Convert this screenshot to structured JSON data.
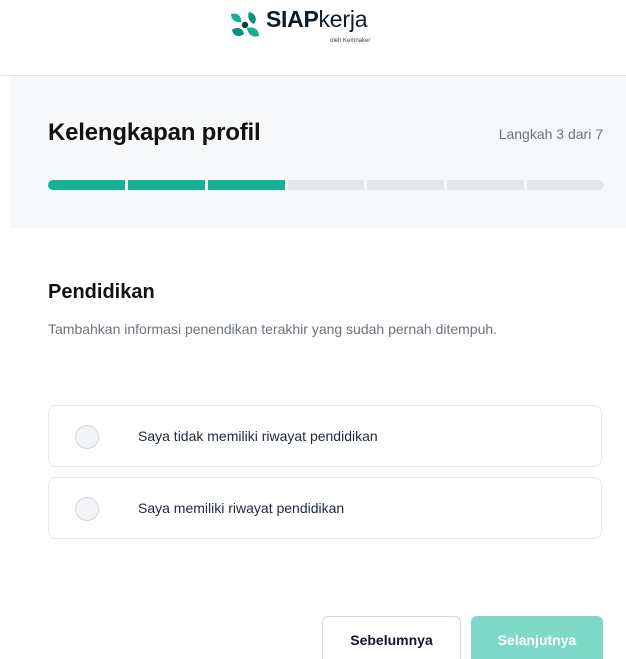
{
  "header": {
    "logo_brand_bold": "SIAP",
    "logo_brand_light": "kerja",
    "logo_sub": "oleh Kemnaker",
    "accent_color": "#16b097"
  },
  "profile": {
    "title": "Kelengkapan profil",
    "step_text": "Langkah 3 dari 7",
    "progress": {
      "current": 3,
      "total": 7
    }
  },
  "section": {
    "title": "Pendidikan",
    "description": "Tambahkan informasi penendikan terakhir yang sudah pernah ditempuh."
  },
  "options": [
    {
      "label": "Saya tidak memiliki riwayat pendidikan",
      "selected": false
    },
    {
      "label": "Saya memiliki riwayat pendidikan",
      "selected": false
    }
  ],
  "buttons": {
    "prev_label": "Sebelumnya",
    "next_label": "Selanjutnya",
    "next_enabled": false
  }
}
